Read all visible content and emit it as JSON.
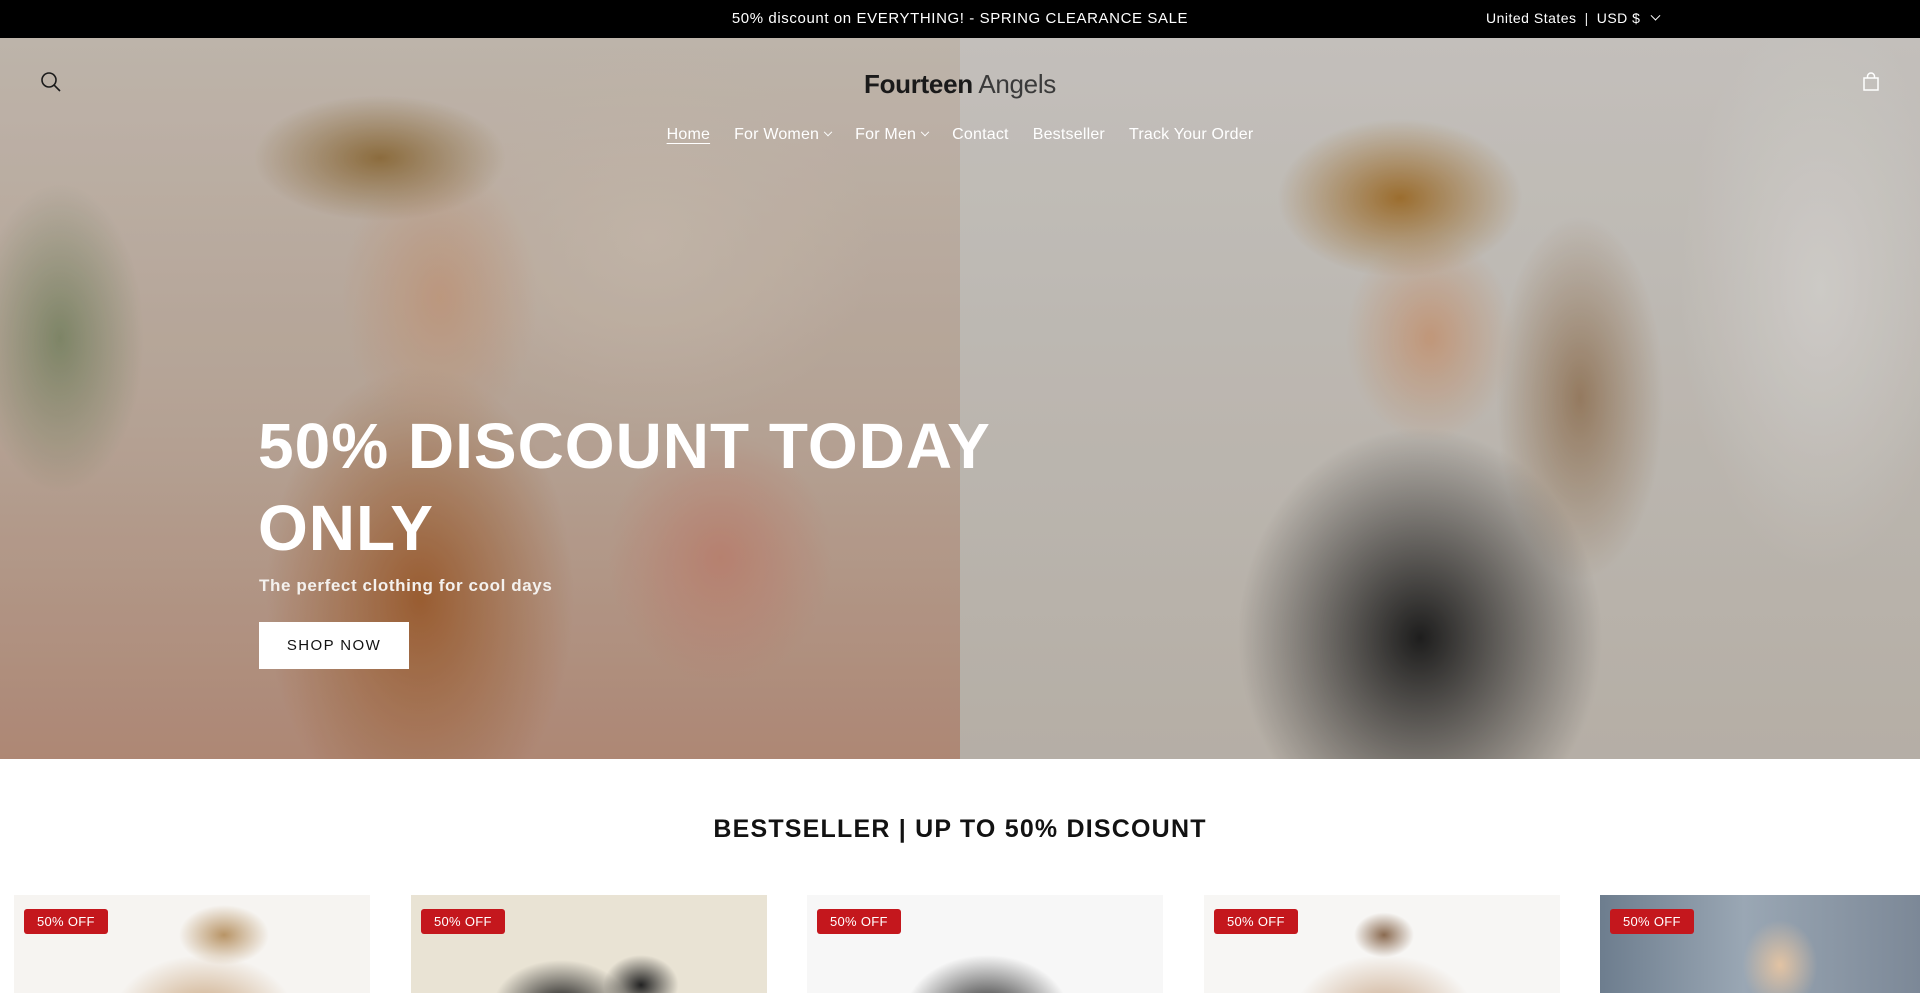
{
  "announcement": {
    "text": "50% discount on EVERYTHING! - SPRING CLEARANCE SALE",
    "country": "United States",
    "separator": "|",
    "currency": "USD $"
  },
  "header": {
    "logo_bold": "Fourteen",
    "logo_light": "Angels",
    "search_icon": "search-icon",
    "cart_icon": "cart-icon",
    "nav": [
      {
        "label": "Home",
        "active": true,
        "dropdown": false
      },
      {
        "label": "For Women",
        "active": false,
        "dropdown": true
      },
      {
        "label": "For Men",
        "active": false,
        "dropdown": true
      },
      {
        "label": "Contact",
        "active": false,
        "dropdown": false
      },
      {
        "label": "Bestseller",
        "active": false,
        "dropdown": false
      },
      {
        "label": "Track Your Order",
        "active": false,
        "dropdown": false
      }
    ]
  },
  "hero": {
    "title_line1": "50% DISCOUNT TODAY",
    "title_line2": "ONLY",
    "subtitle": "The perfect clothing for cool days",
    "button": "SHOP NOW"
  },
  "bestseller": {
    "title": "BESTSELLER | UP TO 50% DISCOUNT",
    "products": [
      {
        "badge": "50% OFF"
      },
      {
        "badge": "50% OFF"
      },
      {
        "badge": "50% OFF"
      },
      {
        "badge": "50% OFF"
      },
      {
        "badge": "50% OFF"
      }
    ]
  },
  "colors": {
    "announcement_bg": "#000000",
    "badge_bg": "#c4171d",
    "text": "#121212"
  }
}
